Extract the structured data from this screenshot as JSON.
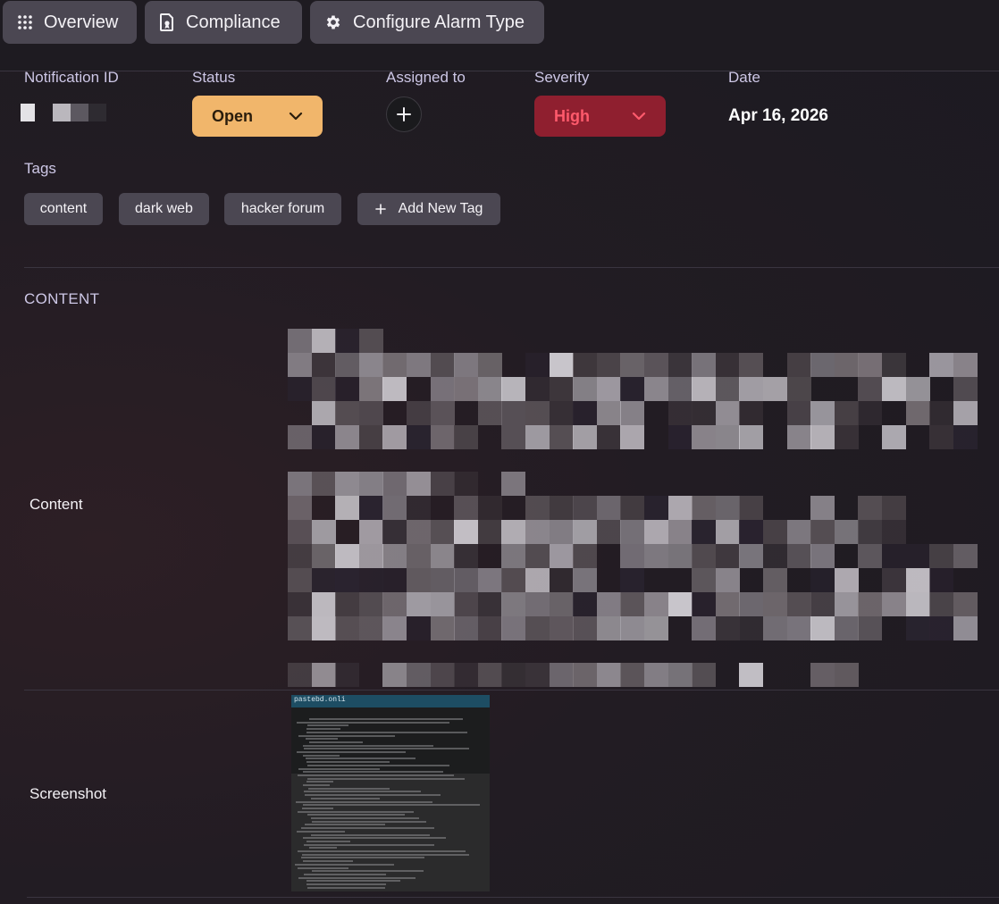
{
  "toolbar": {
    "overview_label": "Overview",
    "compliance_label": "Compliance",
    "configure_label": "Configure Alarm Type"
  },
  "fields": {
    "notification_id_label": "Notification ID",
    "status_label": "Status",
    "status_value": "Open",
    "assigned_label": "Assigned to",
    "severity_label": "Severity",
    "severity_value": "High",
    "date_label": "Date",
    "date_value": "Apr 16, 2026"
  },
  "tags": {
    "label": "Tags",
    "items": [
      "content",
      "dark web",
      "hacker forum"
    ],
    "add_label": "Add New Tag"
  },
  "content_section": {
    "title": "CONTENT",
    "content_label": "Content",
    "screenshot_label": "Screenshot"
  },
  "screenshot": {
    "bar_text": "pastebd.onli"
  },
  "colors": {
    "status_bg": "#f1b66b",
    "severity_bg": "#8f1f2f",
    "severity_text": "#ff5a6c",
    "button_bg": "#4b4752",
    "label_text": "#cdc7e6"
  },
  "icons": {
    "overview": "grid-dots-icon",
    "compliance": "document-badge-icon",
    "configure": "gear-icon",
    "chevron": "chevron-down-icon",
    "assign": "plus-icon",
    "add_tag": "plus-icon"
  }
}
